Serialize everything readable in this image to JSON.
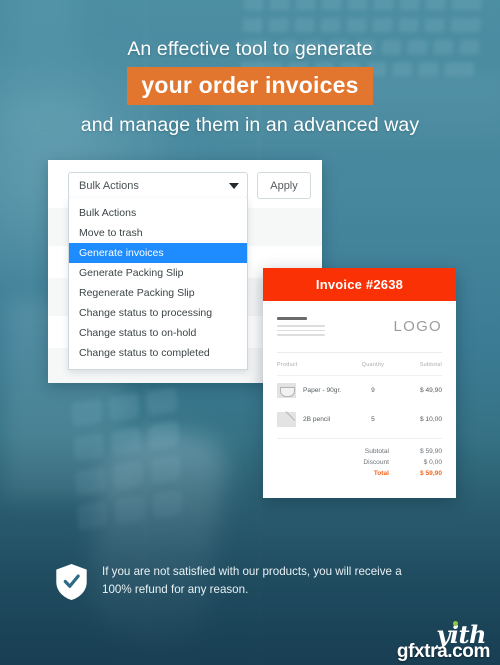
{
  "headline": {
    "line1": "An effective tool to generate",
    "highlight": "your order invoices",
    "line3": "and manage them in an advanced way",
    "highlight_color": "#e2762f"
  },
  "admin_panel": {
    "select": {
      "value": "Bulk Actions",
      "caret_icon": "chevron-down-icon"
    },
    "apply_label": "Apply",
    "dropdown": {
      "selected": "Generate invoices",
      "selected_color": "#1e8cff",
      "items": [
        "Bulk Actions",
        "Move to trash",
        "Generate invoices",
        "Generate Packing Slip",
        "Regenerate Packing Slip",
        "Change status to processing",
        "Change status to on-hold",
        "Change status to completed"
      ]
    }
  },
  "invoice": {
    "header_title": "Invoice #2638",
    "header_color": "#f93105",
    "logo_text": "LOGO",
    "columns": [
      "Product",
      "Quantity",
      "Subtotal"
    ],
    "rows": [
      {
        "icon": "envelope-icon",
        "product": "Paper - 90gr.",
        "quantity": "9",
        "subtotal": "$ 49,90"
      },
      {
        "icon": "pencil-icon",
        "product": "2B pencil",
        "quantity": "5",
        "subtotal": "$ 10,00"
      }
    ],
    "totals": [
      {
        "label": "Subtotal",
        "value": "$ 59,90"
      },
      {
        "label": "Discount",
        "value": "$ 0,00"
      },
      {
        "label": "Total",
        "value": "$ 59,90"
      }
    ],
    "total_color": "#f26722"
  },
  "guarantee": {
    "icon": "shield-check-icon",
    "text": "If you are not satisfied with our products, you will receive a 100% refund for any reason."
  },
  "branding": {
    "logo_text": "yith",
    "dot_color": "#8cc63f",
    "watermark": "gfxtra.com"
  }
}
